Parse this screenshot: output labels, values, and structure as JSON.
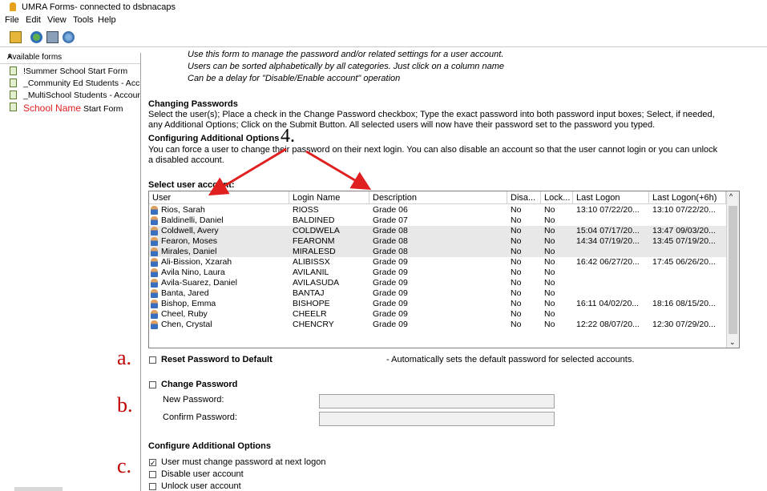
{
  "window": {
    "title": "UMRA Forms- connected to dsbnacaps"
  },
  "menu": [
    "File",
    "Edit",
    "View",
    "Tools",
    "Help"
  ],
  "toolbar_icons": [
    "open-form-icon",
    "refresh-icon",
    "connect-icon",
    "settings-icon"
  ],
  "sidebar": {
    "header": "Available forms",
    "close": "×",
    "items": [
      {
        "label": "!Summer School Start Form"
      },
      {
        "label": "_Community Ed Students - Acc"
      },
      {
        "label": "_MultiSchool Students - Accour"
      },
      {
        "label_red": "School Name",
        "label_rest": " Start Form"
      }
    ]
  },
  "intro": [
    "Use this form to manage the password and/or related settings for a user account.",
    "Users can be sorted alphabetically by all categories. Just click on a column name",
    "Can be a delay for \"Disable/Enable account\" operation"
  ],
  "sections": {
    "changing_title": "Changing Passwords",
    "changing_text_1": "Select the user(s); Place a check in the Change Password checkbox; Type the exact password into both password input boxes; Select, if needed,",
    "changing_text_2": "any Additional Options; Click on the Submit Button.  All selected users will now have their password set to the password you typed.",
    "config_title": "Configuring Additional Options",
    "config_text_1": "You can force a user to change their password on their next login.  You can also disable an account so that the user cannot login or you can unlock",
    "config_text_2": "a disabled account.",
    "select_title": "Select user account:"
  },
  "grid": {
    "columns": [
      "User",
      "Login Name",
      "Description",
      "Disa...",
      "Lock...",
      "Last Logon",
      "Last Logon(+6h)"
    ],
    "sort_indicator": "^",
    "rows": [
      {
        "user": "Rios, Sarah",
        "login": "RIOSS",
        "desc": "Grade 06",
        "dis": "No",
        "lock": "No",
        "last": "13:10 07/22/20...",
        "last6": "13:10 07/22/20...",
        "alt": false
      },
      {
        "user": "Baldinelli, Daniel",
        "login": "BALDINED",
        "desc": "Grade 07",
        "dis": "No",
        "lock": "No",
        "last": "",
        "last6": "",
        "alt": false
      },
      {
        "user": "Coldwell, Avery",
        "login": "COLDWELA",
        "desc": "Grade 08",
        "dis": "No",
        "lock": "No",
        "last": "15:04 07/17/20...",
        "last6": "13:47 09/03/20...",
        "alt": true
      },
      {
        "user": "Fearon, Moses",
        "login": "FEARONM",
        "desc": "Grade 08",
        "dis": "No",
        "lock": "No",
        "last": "14:34 07/19/20...",
        "last6": "13:45 07/19/20...",
        "alt": true
      },
      {
        "user": "Mirales, Daniel",
        "login": "MIRALESD",
        "desc": "Grade 08",
        "dis": "No",
        "lock": "No",
        "last": "",
        "last6": "",
        "alt": true
      },
      {
        "user": "Ali-Bission, Xzarah",
        "login": "ALIBISSX",
        "desc": "Grade 09",
        "dis": "No",
        "lock": "No",
        "last": "16:42 06/27/20...",
        "last6": "17:45 06/26/20...",
        "alt": false
      },
      {
        "user": "Avila Nino, Laura",
        "login": "AVILANIL",
        "desc": "Grade 09",
        "dis": "No",
        "lock": "No",
        "last": "",
        "last6": "",
        "alt": false
      },
      {
        "user": "Avila-Suarez, Daniel",
        "login": "AVILASUDA",
        "desc": "Grade 09",
        "dis": "No",
        "lock": "No",
        "last": "",
        "last6": "",
        "alt": false
      },
      {
        "user": "Banta, Jared",
        "login": "BANTAJ",
        "desc": "Grade 09",
        "dis": "No",
        "lock": "No",
        "last": "",
        "last6": "",
        "alt": false
      },
      {
        "user": "Bishop, Emma",
        "login": "BISHOPE",
        "desc": "Grade 09",
        "dis": "No",
        "lock": "No",
        "last": "16:11 04/02/20...",
        "last6": "18:16 08/15/20...",
        "alt": false
      },
      {
        "user": "Cheel, Ruby",
        "login": "CHEELR",
        "desc": "Grade 09",
        "dis": "No",
        "lock": "No",
        "last": "",
        "last6": "",
        "alt": false
      },
      {
        "user": "Chen, Crystal",
        "login": "CHENCRY",
        "desc": "Grade 09",
        "dis": "No",
        "lock": "No",
        "last": "12:22 08/07/20...",
        "last6": "12:30 07/29/20...",
        "alt": false
      }
    ]
  },
  "reset": {
    "label": "Reset Password to Default",
    "note": "- Automatically sets the default password for selected accounts."
  },
  "change": {
    "label": "Change Password",
    "new_label": "New Password:",
    "confirm_label": "Confirm Password:"
  },
  "additional": {
    "title": "Configure Additional Options",
    "opt1": "User must change password at next logon",
    "opt1_checked": "✓",
    "opt2": "Disable user account",
    "opt3": "Unlock user account"
  },
  "annotations": {
    "a": "a.",
    "b": "b.",
    "c": "c.",
    "four": "4."
  },
  "colors": {
    "annotation": "#c00000",
    "arrow": "#e02020",
    "alt_row": "#e8e8e8"
  }
}
